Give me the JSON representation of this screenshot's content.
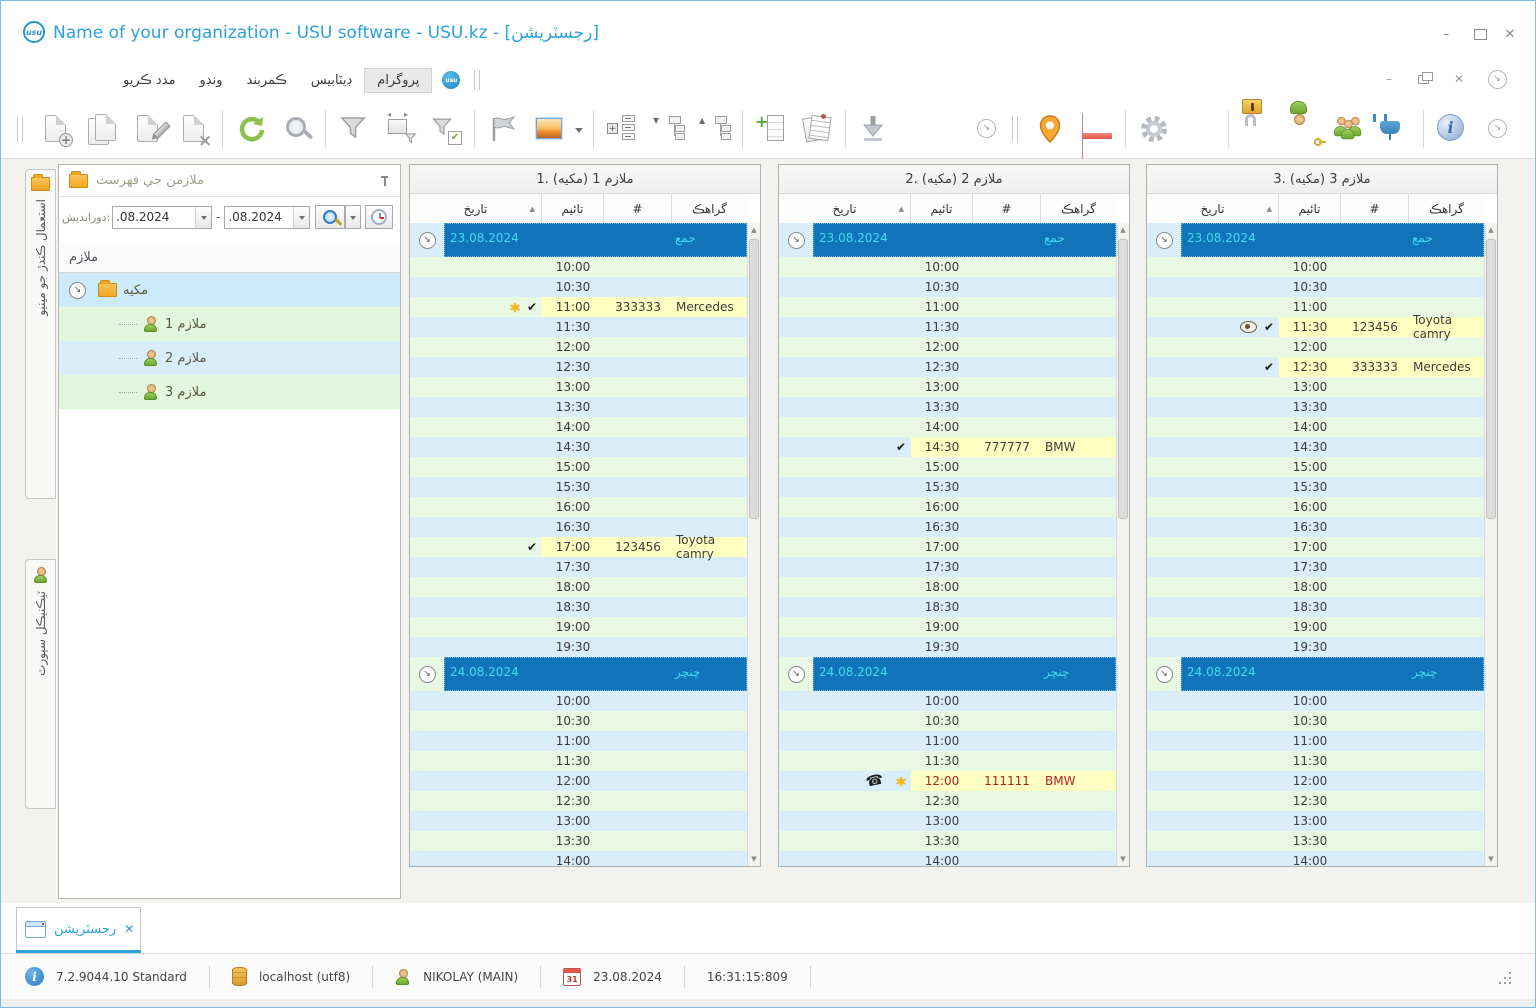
{
  "window": {
    "title": "Name of your organization - USU software - USU.kz - [رجسٽريشن]",
    "logo_text": "usu"
  },
  "menu": {
    "items": [
      "مدد ڪريو",
      "ونڊو",
      "ڪمربند",
      "ڊيٽابيس",
      "پروگرام"
    ],
    "active_item": "پروگرام"
  },
  "toolbar": {
    "left_groups": [
      [
        "doc-new",
        "doc-copy",
        "doc-edit",
        "doc-delete"
      ],
      [
        "refresh",
        "search"
      ],
      [
        "filter",
        "filter-window",
        "filter-check"
      ],
      [
        "flag",
        "image",
        "image-caret"
      ],
      [
        "group-expand",
        "tree-expand",
        "tree-collapse"
      ],
      [
        "row-add",
        "report"
      ],
      [
        "download"
      ]
    ],
    "overflow_icon": "chevron",
    "right_groups": [
      [
        "map-pin",
        "calendar"
      ],
      [
        "gear",
        "colors"
      ],
      [
        "lock",
        "user-key",
        "users",
        "plug"
      ],
      [
        "info"
      ]
    ],
    "trailing_icon": "chevron"
  },
  "side_tabs": [
    {
      "label": "استعمال ڪندڙ جو مينيو",
      "icon": "folder"
    },
    {
      "label": "ٽيڪنيڪل سپورٽ",
      "icon": "person"
    }
  ],
  "sidebar": {
    "title": "ملازمن جي فهرست",
    "filter": {
      "label": "دورانديش:",
      "date_from": ".08.2024",
      "separator": "-",
      "date_to": ".08.2024"
    },
    "tree_header": "ملازم",
    "tree": {
      "group": "مکيه",
      "employees": [
        "ملازم 1",
        "ملازم 2",
        "ملازم 3"
      ]
    }
  },
  "schedule": {
    "column_headers": {
      "date": "تاریخ",
      "time": "تائيم",
      "number": "#",
      "client": "گراهڪ"
    },
    "day1_times": [
      "10:00",
      "10:30",
      "11:00",
      "11:30",
      "12:00",
      "12:30",
      "13:00",
      "13:30",
      "14:00",
      "14:30",
      "15:00",
      "15:30",
      "16:00",
      "16:30",
      "17:00",
      "17:30",
      "18:00",
      "18:30",
      "19:00",
      "19:30"
    ],
    "day2_times": [
      "10:00",
      "10:30",
      "11:00",
      "11:30",
      "12:00",
      "12:30",
      "13:00",
      "13:30",
      "14:00"
    ],
    "sections": [
      {
        "date": "23.08.2024",
        "day_name": "جمع"
      },
      {
        "date": "24.08.2024",
        "day_name": "ڇنڇر"
      }
    ],
    "panels": [
      {
        "title": "ملازم 1 (مکيه) .1",
        "appointments": [
          {
            "date": "23.08.2024",
            "time": "11:00",
            "number": "333333",
            "client": "Mercedes",
            "icons": [
              "asterisk",
              "check"
            ]
          },
          {
            "date": "23.08.2024",
            "time": "17:00",
            "number": "123456",
            "client": "Toyota camry",
            "icons": [
              "check"
            ]
          }
        ]
      },
      {
        "title": "ملازم 2 (مکيه) .2",
        "appointments": [
          {
            "date": "23.08.2024",
            "time": "14:30",
            "number": "777777",
            "client": "BMW",
            "icons": [
              "check"
            ]
          },
          {
            "date": "24.08.2024",
            "time": "12:00",
            "number": "111111",
            "client": "BMW",
            "icons": [
              "phone",
              "asterisk"
            ],
            "alert": true
          }
        ]
      },
      {
        "title": "ملازم 3 (مکيه) .3",
        "appointments": [
          {
            "date": "23.08.2024",
            "time": "11:30",
            "number": "123456",
            "client": "Toyota camry",
            "icons": [
              "eye",
              "check"
            ]
          },
          {
            "date": "23.08.2024",
            "time": "12:30",
            "number": "333333",
            "client": "Mercedes",
            "icons": [
              "check"
            ]
          }
        ]
      }
    ]
  },
  "bottom_tabs": [
    {
      "label": "رجسٽريشن",
      "active": true
    }
  ],
  "status_bar": {
    "version": "7.2.9044.10 Standard",
    "database": "localhost (utf8)",
    "user": "NIKOLAY (MAIN)",
    "date": "23.08.2024",
    "time": "16:31:15:809"
  },
  "colors": {
    "accent_blue": "#2aa2dc",
    "band_blue": "#0f74ba",
    "row_green": "#e8f8e2",
    "row_blue": "#d9eefa",
    "appointment_yellow": "#ffffc2",
    "date_text_cyan": "#49d9f2",
    "alert_red": "#b22222"
  }
}
